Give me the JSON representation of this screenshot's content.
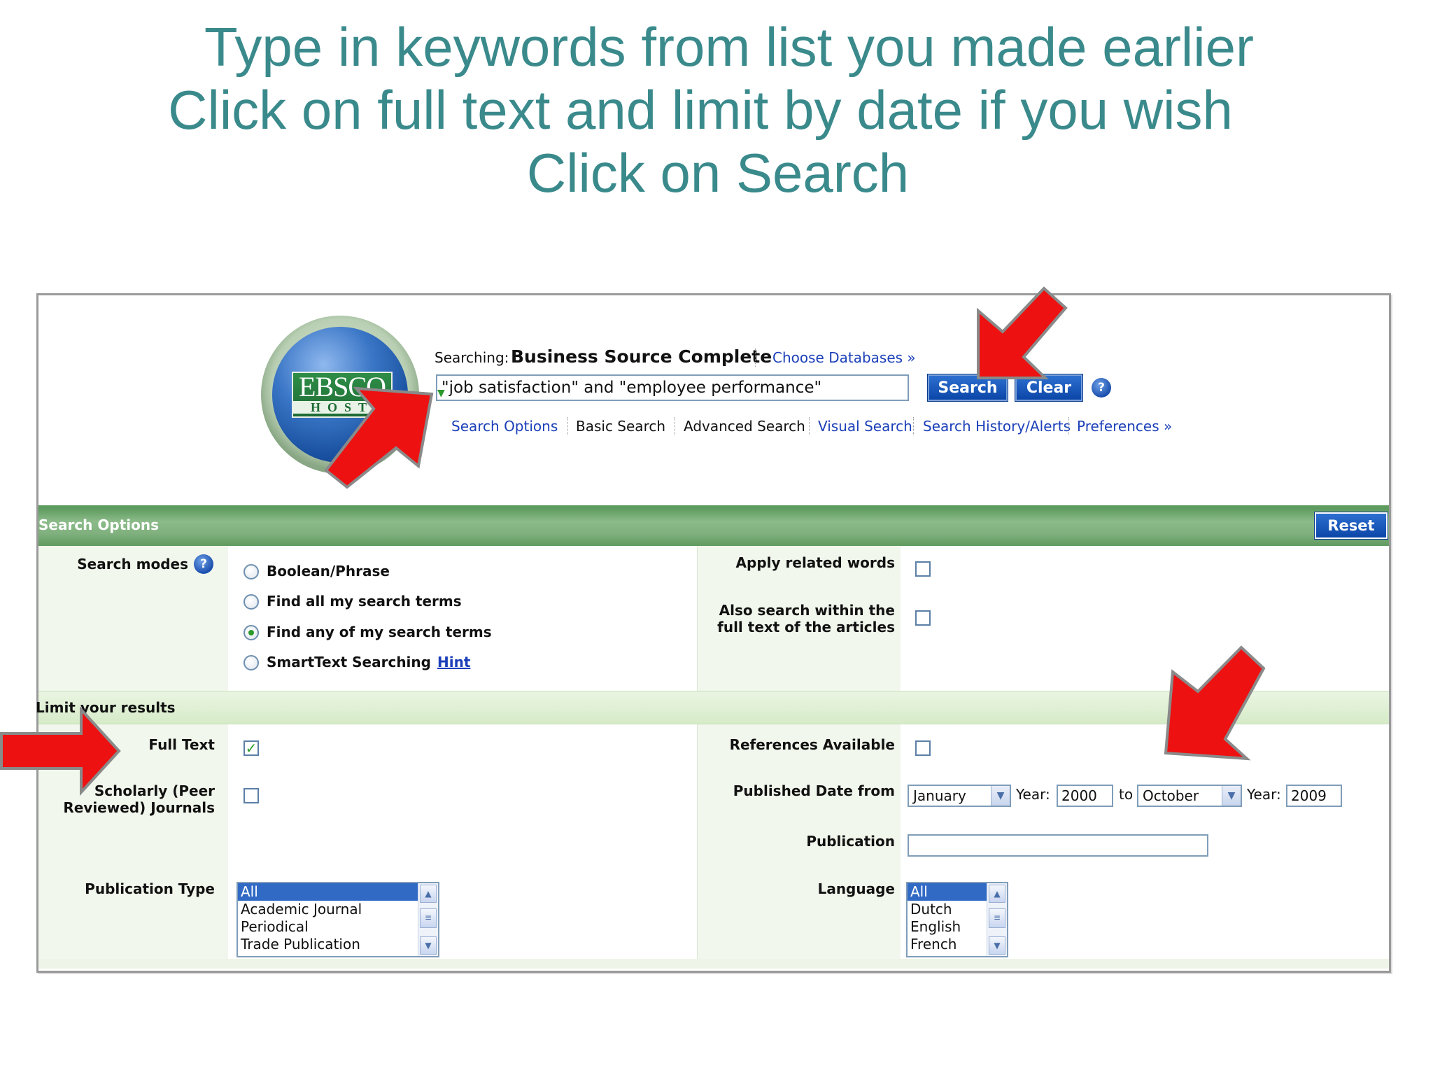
{
  "slide": {
    "title_lines": [
      "Type in keywords from list you made earlier",
      "Click on full text and limit by date if you wish",
      "Click on Search"
    ]
  },
  "header": {
    "logo_text": "EBSCO",
    "logo_subtext": "HOST",
    "searching_label": "Searching:",
    "database_name": "Business Source Complete",
    "choose_databases": "Choose Databases »",
    "search_query": "\"job satisfaction\" and \"employee performance\"",
    "search_button": "Search",
    "clear_button": "Clear",
    "help_icon": "?",
    "nav": {
      "search_options": "Search Options",
      "basic_search": "Basic Search",
      "advanced_search": "Advanced Search",
      "visual_search": "Visual Search",
      "search_history": "Search History/Alerts",
      "preferences": "Preferences »"
    }
  },
  "options": {
    "band_title": "Search Options",
    "reset": "Reset",
    "search_modes_label": "Search modes",
    "modes": [
      {
        "label": "Boolean/Phrase",
        "selected": false
      },
      {
        "label": "Find all my search terms",
        "selected": false
      },
      {
        "label": "Find any of my search terms",
        "selected": true
      },
      {
        "label": "SmartText Searching",
        "selected": false
      }
    ],
    "hint_link": "Hint",
    "apply_related_words": "Apply related words",
    "also_search_line1": "Also search within the",
    "also_search_line2": "full text of the articles"
  },
  "limits": {
    "band_title": "Limit your results",
    "full_text": {
      "label": "Full Text",
      "checked": true,
      "check_mark": "✓"
    },
    "scholarly_line1": "Scholarly (Peer",
    "scholarly_line2": "Reviewed) Journals",
    "references_available": "References Available",
    "published_date_label": "Published Date from",
    "from_month": "January",
    "year_label": "Year:",
    "from_year": "2000",
    "to_label": "to",
    "to_month": "October",
    "to_year": "2009",
    "publication_label": "Publication",
    "publication_value": "",
    "publication_type_label": "Publication Type",
    "publication_types": [
      "All",
      "Academic Journal",
      "Periodical",
      "Trade Publication"
    ],
    "language_label": "Language",
    "languages": [
      "All",
      "Dutch",
      "English",
      "French"
    ]
  },
  "icons": {
    "dropdown": "chevron-down-icon",
    "scroll_up": "scroll-up-icon",
    "scroll_down": "scroll-down-icon",
    "annotation": "red-arrow-icon"
  },
  "colors": {
    "title": "#3a8a8c",
    "button_blue": "#0b46a8",
    "band_green": "#7fb07d",
    "link_blue": "#1b3fb8",
    "annotation_red": "#ee1111"
  }
}
